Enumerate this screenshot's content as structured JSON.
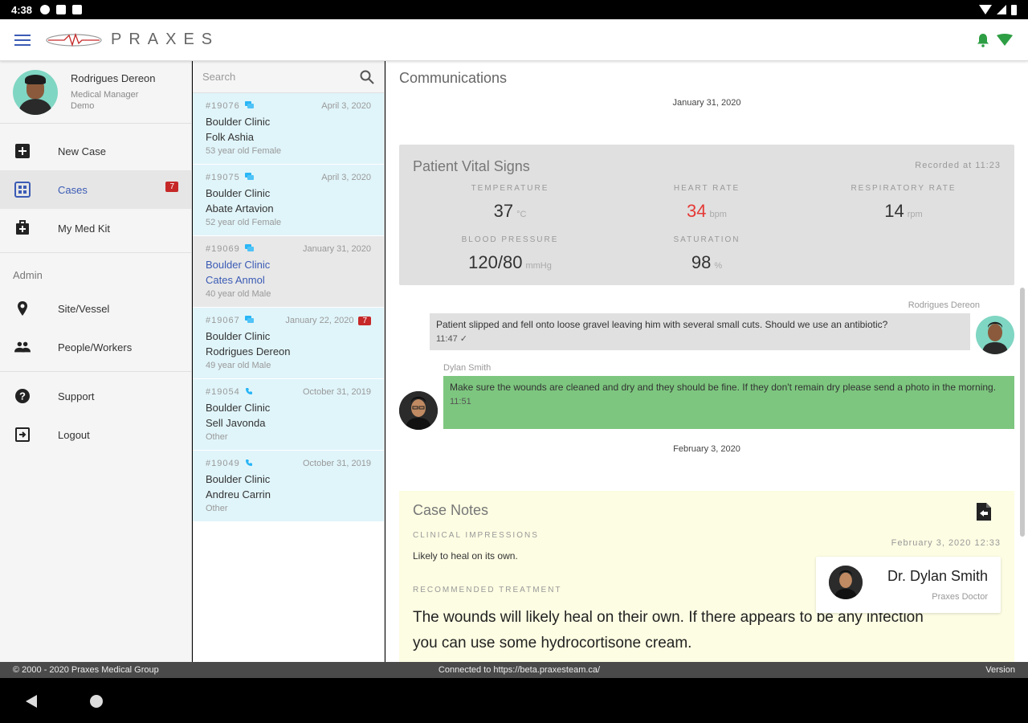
{
  "status_bar": {
    "time": "4:38"
  },
  "app_bar": {
    "logo_text": "PRAXES",
    "brand_color": "#3b5bb5",
    "status_color": "#2e9e44"
  },
  "profile": {
    "name": "Rodrigues Dereon",
    "role": "Medical Manager",
    "org": "Demo"
  },
  "nav": {
    "new_case": "New Case",
    "cases": "Cases",
    "cases_badge": "7",
    "med_kit": "My Med Kit",
    "admin_section": "Admin",
    "site_vessel": "Site/Vessel",
    "people_workers": "People/Workers",
    "support": "Support",
    "logout": "Logout"
  },
  "search": {
    "placeholder": "Search"
  },
  "cases": [
    {
      "number": "#19076",
      "date": "April 3, 2020",
      "site": "Boulder Clinic",
      "name": "Folk Ashia",
      "desc": "53 year old Female",
      "icon": "chat-icon"
    },
    {
      "number": "#19075",
      "date": "April 3, 2020",
      "site": "Boulder Clinic",
      "name": "Abate Artavion",
      "desc": "52 year old Female",
      "icon": "chat-icon"
    },
    {
      "number": "#19069",
      "date": "January 31, 2020",
      "site": "Boulder Clinic",
      "name": "Cates Anmol",
      "desc": "40 year old Male",
      "icon": "chat-icon"
    },
    {
      "number": "#19067",
      "date": "January 22, 2020",
      "site": "Boulder Clinic",
      "name": "Rodrigues Dereon",
      "desc": "49 year old Male",
      "icon": "chat-icon",
      "badge": "7"
    },
    {
      "number": "#19054",
      "date": "October 31, 2019",
      "site": "Boulder Clinic",
      "name": "Sell Javonda",
      "desc": "Other",
      "icon": "phone-icon"
    },
    {
      "number": "#19049",
      "date": "October 31, 2019",
      "site": "Boulder Clinic",
      "name": "Andreu Carrin",
      "desc": "Other",
      "icon": "phone-icon"
    }
  ],
  "main": {
    "title": "Communications",
    "date1": "January 31, 2020",
    "vitals": {
      "title": "Patient Vital Signs",
      "recorded": "Recorded at 11:23",
      "temperature": {
        "label": "TEMPERATURE",
        "value": "37",
        "unit": "°C"
      },
      "heart_rate": {
        "label": "HEART RATE",
        "value": "34",
        "unit": "bpm"
      },
      "respiratory_rate": {
        "label": "RESPIRATORY RATE",
        "value": "14",
        "unit": "rpm"
      },
      "blood_pressure": {
        "label": "BLOOD PRESSURE",
        "value": "120/80",
        "unit": "mmHg"
      },
      "saturation": {
        "label": "SATURATION",
        "value": "98",
        "unit": "%"
      }
    },
    "messages": [
      {
        "sender": "Rodrigues Dereon",
        "text": "Patient slipped and fell onto loose gravel leaving him with several small cuts. Should we use an antibiotic?",
        "time": "11:47 ✓"
      },
      {
        "sender": "Dylan Smith",
        "text": "Make sure the wounds are cleaned and dry and they should be fine. If they don't remain dry please send a photo in the morning.",
        "time": "11:51"
      }
    ],
    "date2": "February 3, 2020",
    "notes": {
      "title": "Case Notes",
      "clinical_label": "CLINICAL IMPRESSIONS",
      "clinical_text": "Likely to heal on its own.",
      "date": "February 3, 2020 12:33",
      "treatment_label": "RECOMMENDED TREATMENT",
      "treatment_text": "The wounds will likely heal on their own. If there appears to be any infection you can use some hydrocortisone cream.",
      "doctor_name": "Dr. Dylan Smith",
      "doctor_role": "Praxes Doctor"
    }
  },
  "footer": {
    "copyright": "© 2000 - 2020 Praxes Medical Group",
    "connection": "Connected to https://beta.praxesteam.ca/",
    "version": "Version"
  }
}
